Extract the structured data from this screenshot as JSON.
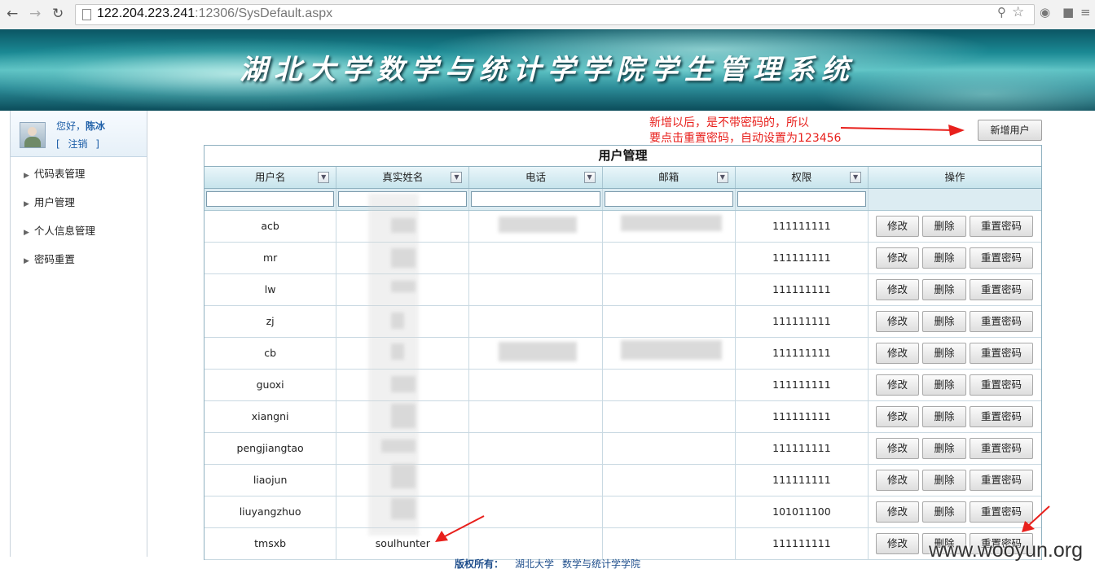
{
  "browser": {
    "url_host": "122.204.223.241",
    "url_path": ":12306/SysDefault.aspx"
  },
  "banner": {
    "title": "湖北大学数学与统计学学院学生管理系统"
  },
  "sidebar": {
    "greeting": "您好，",
    "user_name": "陈冰",
    "logout": "[ 注销 ]",
    "items": [
      {
        "label": "代码表管理"
      },
      {
        "label": "用户管理"
      },
      {
        "label": "个人信息管理"
      },
      {
        "label": "密码重置"
      }
    ]
  },
  "toolbar": {
    "add_user_label": "新增用户"
  },
  "annotation": {
    "line1": "新增以后，是不带密码的，所以",
    "line2": "要点击重置密码，自动设置为123456",
    "color": "#e8201c"
  },
  "grid": {
    "title": "用户管理",
    "columns": [
      "用户名",
      "真实姓名",
      "电话",
      "邮箱",
      "权限",
      "操作"
    ],
    "actions": {
      "edit": "修改",
      "delete": "删除",
      "reset": "重置密码"
    },
    "rows": [
      {
        "username": "acb",
        "realname": "",
        "phone": "",
        "email": "",
        "perm": "111111111"
      },
      {
        "username": "mr",
        "realname": "",
        "phone": "",
        "email": "",
        "perm": "111111111"
      },
      {
        "username": "lw",
        "realname": "",
        "phone": "",
        "email": "",
        "perm": "111111111"
      },
      {
        "username": "zj",
        "realname": "",
        "phone": "",
        "email": "",
        "perm": "111111111"
      },
      {
        "username": "cb",
        "realname": "",
        "phone": "",
        "email": "",
        "perm": "111111111"
      },
      {
        "username": "guoxi",
        "realname": "",
        "phone": "",
        "email": "",
        "perm": "111111111"
      },
      {
        "username": "xiangni",
        "realname": "",
        "phone": "",
        "email": "",
        "perm": "111111111"
      },
      {
        "username": "pengjiangtao",
        "realname": "",
        "phone": "",
        "email": "",
        "perm": "111111111"
      },
      {
        "username": "liaojun",
        "realname": "",
        "phone": "",
        "email": "",
        "perm": "111111111"
      },
      {
        "username": "liuyangzhuo",
        "realname": "",
        "phone": "",
        "email": "",
        "perm": "101011100"
      },
      {
        "username": "tmsxb",
        "realname": "soulhunter",
        "phone": "",
        "email": "",
        "perm": "111111111"
      }
    ]
  },
  "footer": {
    "label": "版权所有：",
    "org": "湖北大学",
    "dept": "数学与统计学学院"
  },
  "watermark": "www.wooyun.org"
}
